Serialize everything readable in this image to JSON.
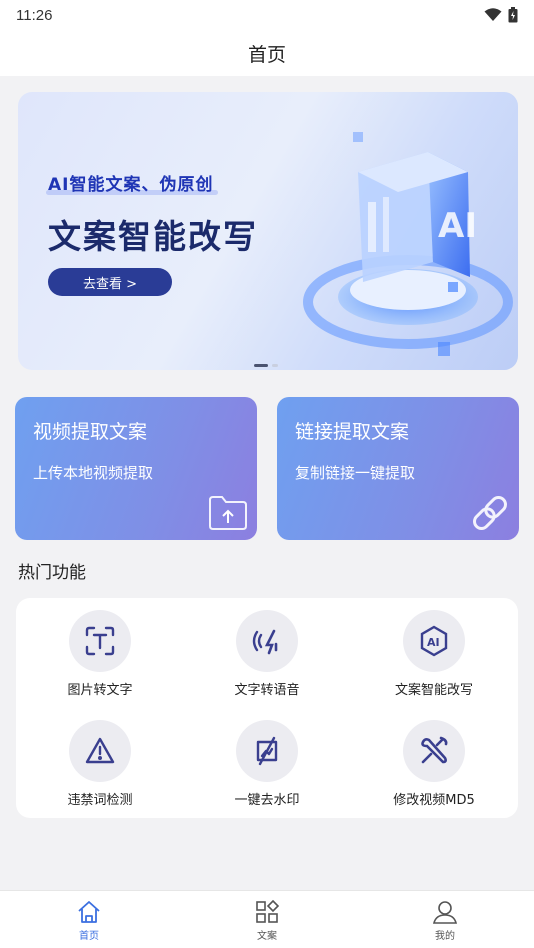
{
  "status": {
    "time": "11:26"
  },
  "header": {
    "title": "首页"
  },
  "banner": {
    "tag": "AI智能文案、伪原创",
    "title": "文案智能改写",
    "button": "去查看 >",
    "art_text": "AI"
  },
  "cards": [
    {
      "title": "视频提取文案",
      "subtitle": "上传本地视频提取",
      "icon": "folder-upload-icon"
    },
    {
      "title": "链接提取文案",
      "subtitle": "复制链接一键提取",
      "icon": "link-icon"
    }
  ],
  "hot": {
    "title": "热门功能",
    "items": [
      {
        "label": "图片转文字",
        "icon": "text-scan-icon"
      },
      {
        "label": "文字转语音",
        "icon": "voice-icon"
      },
      {
        "label": "文案智能改写",
        "icon": "ai-icon"
      },
      {
        "label": "违禁词检测",
        "icon": "warning-icon"
      },
      {
        "label": "一键去水印",
        "icon": "watermark-remove-icon"
      },
      {
        "label": "修改视频MD5",
        "icon": "tools-icon"
      }
    ]
  },
  "tabbar": {
    "items": [
      {
        "label": "首页",
        "icon": "home-icon",
        "active": true
      },
      {
        "label": "文案",
        "icon": "grid-icon",
        "active": false
      },
      {
        "label": "我的",
        "icon": "user-icon",
        "active": false
      }
    ]
  },
  "colors": {
    "accent": "#3b6fe0",
    "icon": "#3a3f8f",
    "card_gradient_start": "#6fa0f0",
    "card_gradient_end": "#8c7fe0"
  }
}
